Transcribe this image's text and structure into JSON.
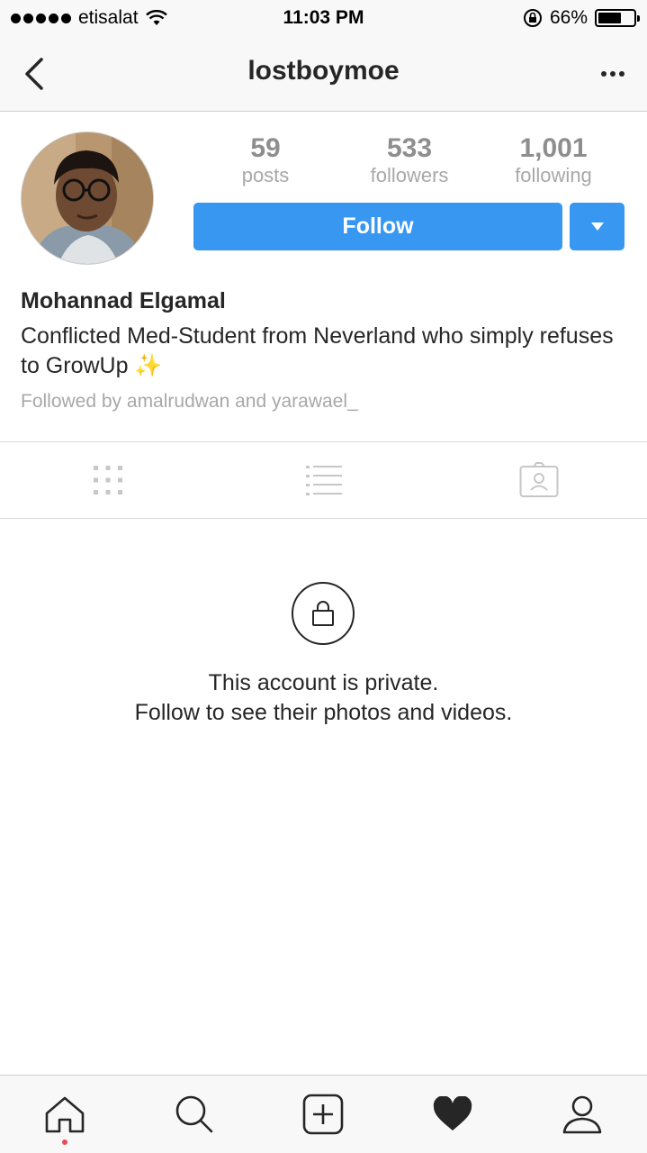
{
  "status_bar": {
    "carrier": "etisalat",
    "time": "11:03 PM",
    "battery_percent": "66%",
    "battery_level": 0.66,
    "icons": [
      "signal-dots-icon",
      "wifi-icon",
      "orientation-lock-icon",
      "battery-icon"
    ]
  },
  "nav": {
    "title": "lostboymoe",
    "back_icon": "chevron-left-icon",
    "more_icon": "more-horizontal-icon"
  },
  "profile": {
    "stats": [
      {
        "value": "59",
        "label": "posts"
      },
      {
        "value": "533",
        "label": "followers"
      },
      {
        "value": "1,001",
        "label": "following"
      }
    ],
    "follow_label": "Follow",
    "full_name": "Mohannad Elgamal",
    "bio": "Conflicted Med-Student from Neverland who simply refuses to GrowUp ✨",
    "followed_by": "Followed by amalrudwan and yarawael_",
    "accent_color": "#3897f0"
  },
  "tabs": [
    {
      "name": "grid-view",
      "icon": "grid-icon"
    },
    {
      "name": "list-view",
      "icon": "list-icon"
    },
    {
      "name": "tagged",
      "icon": "tagged-photos-icon"
    }
  ],
  "private_notice": {
    "line1": "This account is private.",
    "line2": "Follow to see their photos and videos.",
    "icon": "lock-icon"
  },
  "bottom_bar": [
    {
      "name": "home",
      "icon": "home-icon",
      "has_notification": true
    },
    {
      "name": "search",
      "icon": "search-icon"
    },
    {
      "name": "new-post",
      "icon": "plus-square-icon"
    },
    {
      "name": "activity",
      "icon": "heart-icon"
    },
    {
      "name": "profile",
      "icon": "person-icon"
    }
  ]
}
